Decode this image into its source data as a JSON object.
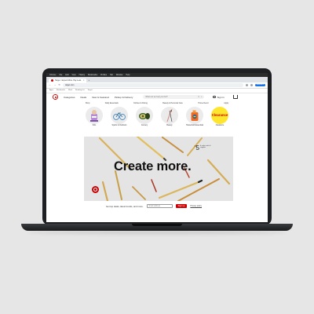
{
  "browser": {
    "menubar": [
      "Chrome",
      "File",
      "Edit",
      "View",
      "History",
      "Bookmarks",
      "Profiles",
      "Tab",
      "Window",
      "Help"
    ],
    "tab_title": "Target : Expect More. Pay Less.",
    "tab_close": "×",
    "new_tab": "+",
    "back": "←",
    "forward": "→",
    "reload": "↻",
    "url": "target.com",
    "profile": "Relaunch",
    "bookmarks": [
      "Apps",
      "Bookmarks",
      "Work",
      "Reading list",
      "Target"
    ]
  },
  "site": {
    "nav": [
      "Categories",
      "Deals",
      "New & Featured",
      "Pickup & Delivery"
    ],
    "search_placeholder": "What can we help you find?",
    "search_clear": "×",
    "search_icon": "⌕",
    "signin": "Sign in"
  },
  "promo_strip": [
    "Shop",
    "Daily Essentials",
    "Kitchen & Dining",
    "Beauty & Personal Care",
    "Home Decor",
    "Apply"
  ],
  "circles": [
    {
      "label": "Kids"
    },
    {
      "label": "Sports & Outdoors"
    },
    {
      "label": "Grocery"
    },
    {
      "label": "Beauty"
    },
    {
      "label": "Household Essentials"
    },
    {
      "label": "Clearance"
    }
  ],
  "clearance_badge": "Clearance",
  "hero": {
    "headline": "Create more.",
    "price_symbol": "$",
    "price": "5",
    "price_note": "& under crafts & supplies"
  },
  "signup": {
    "text": "Get top deals, latest trends, and more.",
    "placeholder": "Email address",
    "button": "Sign up",
    "link": "Privacy policy"
  },
  "colors": {
    "brand_red": "#cc0000",
    "clearance_yellow": "#ffe62e",
    "laptop_body": "#1e1f22",
    "backdrop": "#e6e6e6"
  }
}
